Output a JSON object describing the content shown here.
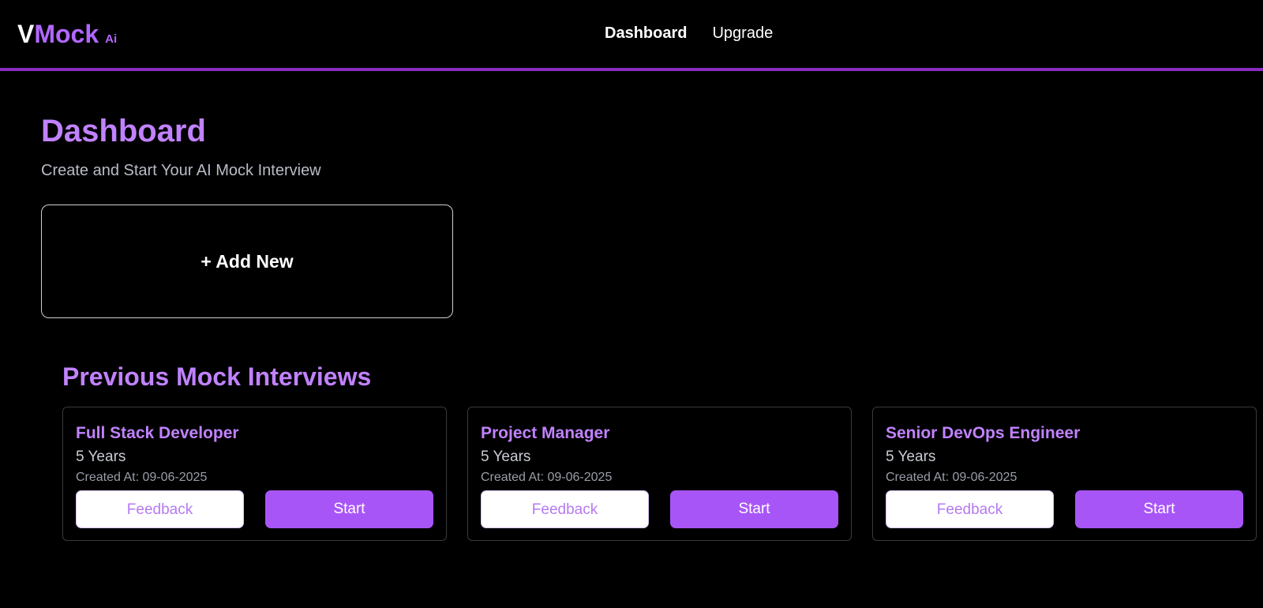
{
  "header": {
    "logo": {
      "v": "V",
      "mock": "Mock",
      "ai": "Ai"
    },
    "nav": [
      {
        "label": "Dashboard",
        "active": true
      },
      {
        "label": "Upgrade",
        "active": false
      }
    ],
    "accent_color": "#8a2bbf"
  },
  "main": {
    "title": "Dashboard",
    "subtitle": "Create and Start Your AI Mock Interview",
    "add_new_label": "+ Add New",
    "previous_title": "Previous Mock Interviews",
    "interviews": [
      {
        "role": "Full Stack Developer",
        "experience": "5 Years",
        "created": "Created At: 09-06-2025",
        "feedback_label": "Feedback",
        "start_label": "Start"
      },
      {
        "role": "Project Manager",
        "experience": "5 Years",
        "created": "Created At: 09-06-2025",
        "feedback_label": "Feedback",
        "start_label": "Start"
      },
      {
        "role": "Senior DevOps Engineer",
        "experience": "5 Years",
        "created": "Created At: 09-06-2025",
        "feedback_label": "Feedback",
        "start_label": "Start"
      }
    ]
  },
  "colors": {
    "brand_purple": "#c182ff",
    "button_purple": "#a855f7",
    "background": "#000000"
  }
}
